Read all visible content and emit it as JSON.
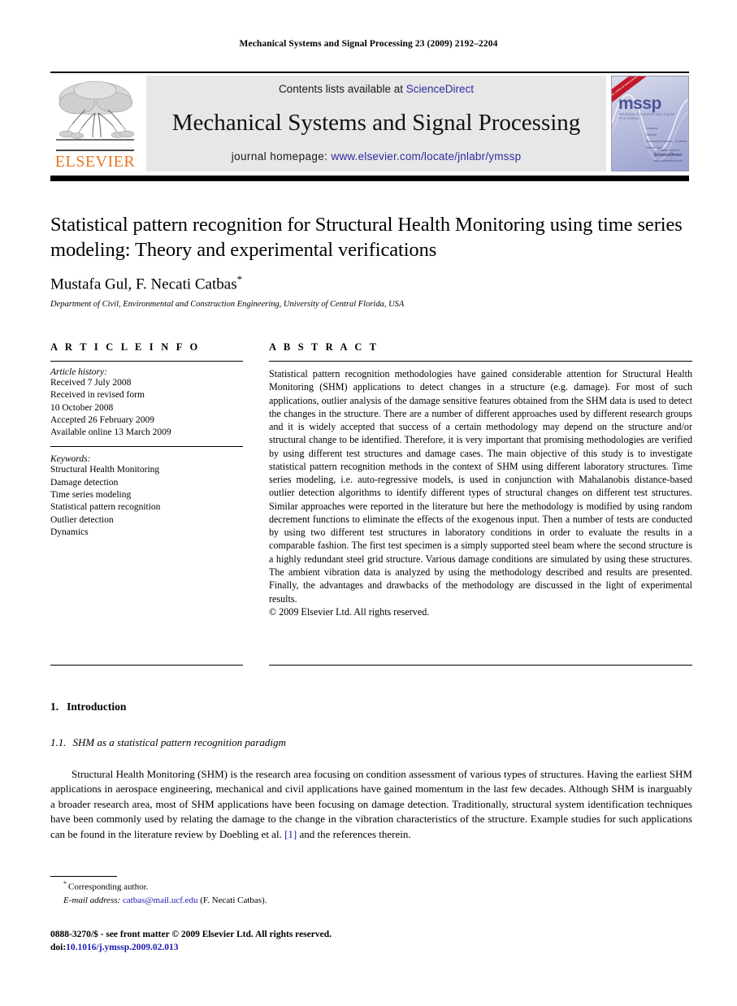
{
  "running_head": "Mechanical Systems and Signal Processing 23 (2009) 2192–2204",
  "banner": {
    "contents_prefix": "Contents lists available at ",
    "sciencedirect": "ScienceDirect",
    "journal_title": "Mechanical Systems and Signal Processing",
    "homepage_prefix": "journal homepage: ",
    "homepage_url": "www.elsevier.com/locate/jnlabr/ymssp",
    "publisher": "ELSEVIER",
    "cover": {
      "logo_text": "mssp",
      "subtitle": "Mechanical Systems and Signal Processing",
      "ribbon": "Available online at www.sciencedirect.com",
      "toc_lines": [
        "Contents",
        "Editorial",
        "Mechanical Systems - Contents",
        "Review Topic"
      ],
      "footer_small": "Available online at",
      "footer_brand": "ScienceDirect",
      "footer_url": "www.sciencedirect.com"
    }
  },
  "title": "Statistical pattern recognition for Structural Health Monitoring using time series modeling: Theory and experimental verifications",
  "authors": "Mustafa Gul, F. Necati Catbas",
  "author_star": "*",
  "affiliation": "Department of Civil, Environmental and Construction Engineering, University of Central Florida, USA",
  "article_info": {
    "heading": "A R T I C L E   I N F O",
    "history_label": "Article history:",
    "history": [
      "Received 7 July 2008",
      "Received in revised form",
      "10 October 2008",
      "Accepted 26 February 2009",
      "Available online 13 March 2009"
    ],
    "keywords_label": "Keywords:",
    "keywords": [
      "Structural Health Monitoring",
      "Damage detection",
      "Time series modeling",
      "Statistical pattern recognition",
      "Outlier detection",
      "Dynamics"
    ]
  },
  "abstract": {
    "heading": "A B S T R A C T",
    "text": "Statistical pattern recognition methodologies have gained considerable attention for Structural Health Monitoring (SHM) applications to detect changes in a structure (e.g. damage). For most of such applications, outlier analysis of the damage sensitive features obtained from the SHM data is used to detect the changes in the structure. There are a number of different approaches used by different research groups and it is widely accepted that success of a certain methodology may depend on the structure and/or structural change to be identified. Therefore, it is very important that promising methodologies are verified by using different test structures and damage cases. The main objective of this study is to investigate statistical pattern recognition methods in the context of SHM using different laboratory structures. Time series modeling, i.e. auto-regressive models, is used in conjunction with Mahalanobis distance-based outlier detection algorithms to identify different types of structural changes on different test structures. Similar approaches were reported in the literature but here the methodology is modified by using random decrement functions to eliminate the effects of the exogenous input. Then a number of tests are conducted by using two different test structures in laboratory conditions in order to evaluate the results in a comparable fashion. The first test specimen is a simply supported steel beam where the second structure is a highly redundant steel grid structure. Various damage conditions are simulated by using these structures. The ambient vibration data is analyzed by using the methodology described and results are presented. Finally, the advantages and drawbacks of the methodology are discussed in the light of experimental results.",
    "copyright": "© 2009 Elsevier Ltd. All rights reserved."
  },
  "body": {
    "section_number": "1.",
    "section_title": "Introduction",
    "subsection_number": "1.1.",
    "subsection_title": "SHM as a statistical pattern recognition paradigm",
    "paragraph_before_ref": "Structural Health Monitoring (SHM) is the research area focusing on condition assessment of various types of structures. Having the earliest SHM applications in aerospace engineering, mechanical and civil applications have gained momentum in the last few decades. Although SHM is inarguably a broader research area, most of SHM applications have been focusing on damage detection. Traditionally, structural system identification techniques have been commonly used by relating the damage to the change in the vibration characteristics of the structure. Example studies for such applications can be found in the literature review by Doebling et al. ",
    "reference_link": "[1]",
    "paragraph_after_ref": " and the references therein."
  },
  "footnotes": {
    "star": "*",
    "corresponding": "Corresponding author.",
    "email_label": "E-mail address:",
    "email": "catbas@mail.ucf.edu",
    "email_owner": "(F. Necati Catbas).",
    "issn_line": "0888-3270/$ - see front matter © 2009 Elsevier Ltd. All rights reserved.",
    "doi_label": "doi:",
    "doi_value": "10.1016/j.ymssp.2009.02.013"
  },
  "colors": {
    "link_blue": "#2d2d9e",
    "ref_blue": "#1b1bb3",
    "elsevier_orange": "#E87722",
    "banner_gray": "#e7e7e7",
    "cover_purple": "#9aa0cf"
  }
}
